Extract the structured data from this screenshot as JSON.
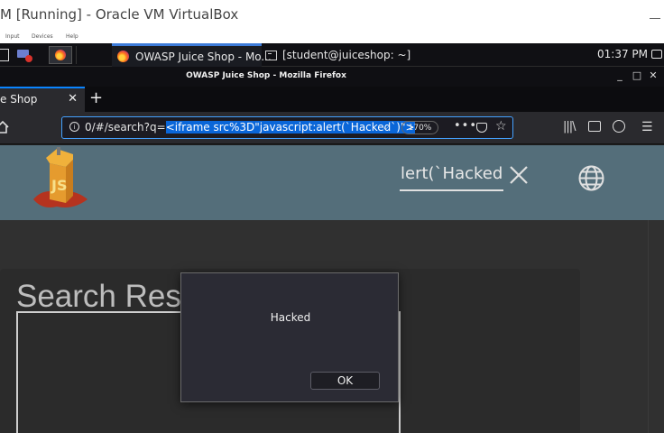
{
  "vbox": {
    "title": "M [Running] - Oracle VM VirtualBox",
    "menu": [
      "Input",
      "Devices",
      "Help"
    ]
  },
  "taskbar": {
    "tasks": [
      {
        "label": "OWASP Juice Shop - Mo...",
        "icon": "firefox-icon"
      },
      {
        "label": "[student@juiceshop: ~]",
        "icon": "terminal-icon"
      }
    ],
    "clock": "01:37 PM"
  },
  "firefox": {
    "window_title": "OWASP Juice Shop - Mozilla Firefox",
    "tab_label": "e Shop",
    "url_prefix": "0/#/search?q=",
    "url_selected": "<iframe src%3D\"javascript:alert(`Hacked`)\">",
    "zoom": "170%"
  },
  "page": {
    "search_value": "lert(`Hacked",
    "results_heading": "Search Res"
  },
  "alert": {
    "message": "Hacked",
    "ok_label": "OK"
  },
  "colors": {
    "toolbar": "#546e7a",
    "page_bg": "#303030",
    "url_focus": "#45a1ff",
    "tab_accent": "#0a84ff"
  }
}
